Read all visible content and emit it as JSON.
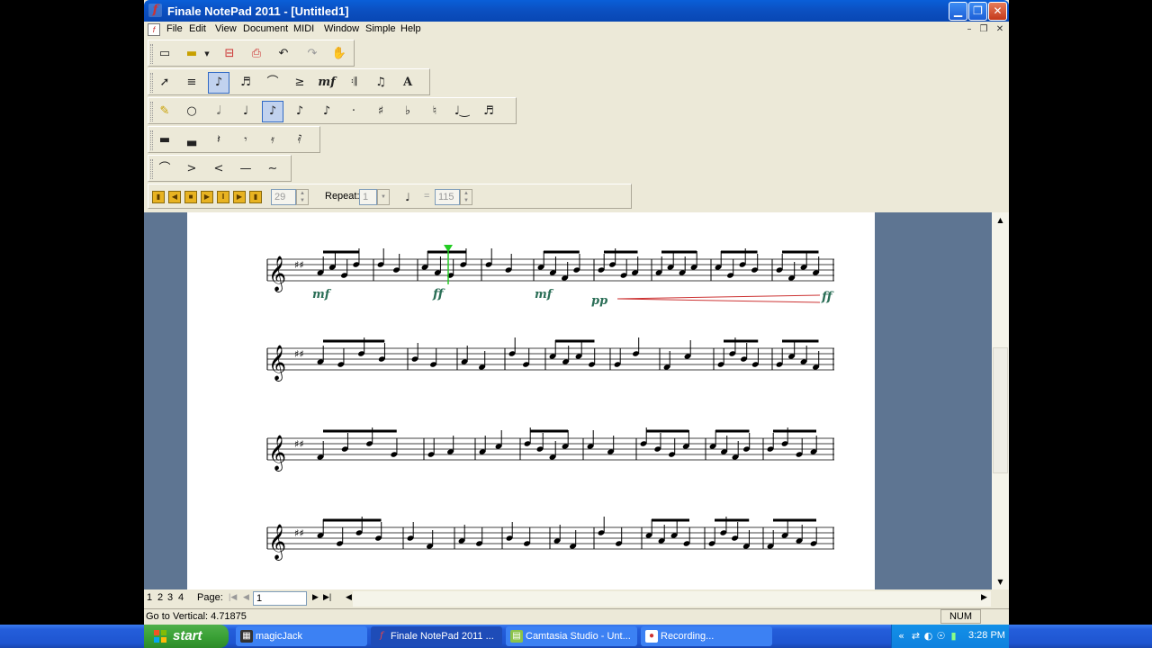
{
  "window": {
    "title": "Finale NotePad 2011 - [Untitled1]",
    "app_icon": "finale-f-icon"
  },
  "menu": [
    "File",
    "Edit",
    "View",
    "Document",
    "MIDI",
    "Window",
    "Simple",
    "Help"
  ],
  "toolbars": {
    "file": [
      "new-icon",
      "open-icon",
      "dropdown-arrow-icon",
      "print-preview-icon",
      "print-icon",
      "undo-icon",
      "redo-icon",
      "hand-grabber-icon"
    ],
    "main_tools": [
      "selection-tool-icon",
      "staff-tool-icon",
      "simple-entry-icon",
      "tuplet-tool-icon",
      "smart-shape-icon",
      "articulation-tool-icon",
      "expression-tool-icon",
      "repeat-tool-icon",
      "lyrics-tool-icon",
      "text-tool-icon"
    ],
    "simple_entry": [
      "eraser-icon",
      "whole-note-icon",
      "half-note-icon",
      "quarter-note-icon",
      "eighth-note-icon",
      "sixteenth-note-icon",
      "thirtysecond-note-icon",
      "dot-icon",
      "sharp-icon",
      "flat-icon",
      "natural-icon",
      "tie-icon",
      "tuplet-icon"
    ],
    "rests": [
      "whole-rest-icon",
      "half-rest-icon",
      "quarter-rest-icon",
      "eighth-rest-icon",
      "sixteenth-rest-icon",
      "thirtysecond-rest-icon"
    ],
    "smart_shapes": [
      "slur-icon",
      "decrescendo-icon",
      "crescendo-icon",
      "line-icon",
      "glissando-icon"
    ]
  },
  "playback": {
    "measure_value": "29",
    "repeat_label": "Repeat:",
    "repeat_value": "1",
    "equals": "=",
    "tempo_value": "115"
  },
  "score": {
    "dynamics": [
      "mf",
      "ff",
      "mf",
      "pp",
      "ff"
    ],
    "key_signature": "D major",
    "systems": 4
  },
  "pagebar": {
    "pages": [
      "1",
      "2",
      "3",
      "4"
    ],
    "page_label": "Page:",
    "page_value": "1"
  },
  "status": {
    "message": "Go to Vertical: 4.71875",
    "num": "NUM"
  },
  "taskbar": {
    "start": "start",
    "buttons": [
      {
        "label": "magicJack",
        "icon": "calculator-icon"
      },
      {
        "label": "Finale NotePad 2011 ...",
        "icon": "finale-f-icon"
      },
      {
        "label": "Camtasia Studio - Unt...",
        "icon": "camtasia-icon"
      },
      {
        "label": "Recording...",
        "icon": "recording-icon"
      }
    ],
    "clock": "3:28 PM"
  }
}
